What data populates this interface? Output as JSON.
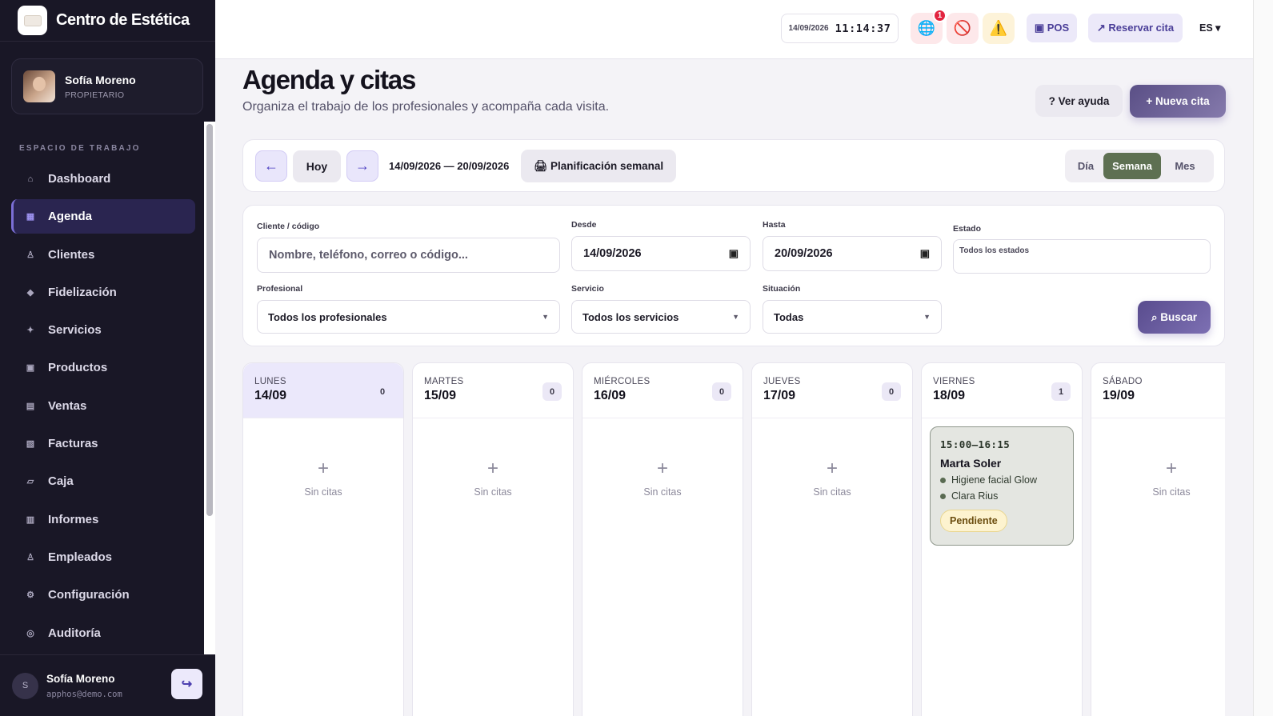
{
  "brand": {
    "name": "Centro de Estética"
  },
  "profile": {
    "name": "Sofía Moreno",
    "role": "PROPIETARIO"
  },
  "sidebar": {
    "section_label": "ESPACIO DE TRABAJO",
    "items": [
      {
        "label": "Dashboard",
        "icon": "⌂",
        "icon_name": "home-icon"
      },
      {
        "label": "Agenda",
        "icon": "▦",
        "icon_name": "calendar-icon",
        "active": true
      },
      {
        "label": "Clientes",
        "icon": "♙",
        "icon_name": "user-icon"
      },
      {
        "label": "Fidelización",
        "icon": "◆",
        "icon_name": "diamond-icon"
      },
      {
        "label": "Servicios",
        "icon": "✦",
        "icon_name": "sparkle-icon"
      },
      {
        "label": "Productos",
        "icon": "▣",
        "icon_name": "box-icon"
      },
      {
        "label": "Ventas",
        "icon": "▤",
        "icon_name": "receipt-icon"
      },
      {
        "label": "Facturas",
        "icon": "▧",
        "icon_name": "invoice-icon"
      },
      {
        "label": "Caja",
        "icon": "▱",
        "icon_name": "cash-register-icon"
      },
      {
        "label": "Informes",
        "icon": "▥",
        "icon_name": "report-icon"
      },
      {
        "label": "Empleados",
        "icon": "♙",
        "icon_name": "employees-icon"
      },
      {
        "label": "Configuración",
        "icon": "⚙",
        "icon_name": "gear-icon"
      },
      {
        "label": "Auditoría",
        "icon": "◎",
        "icon_name": "audit-icon"
      }
    ]
  },
  "footer": {
    "avatar": "S",
    "name": "Sofía Moreno",
    "email": "apphos@demo.com",
    "logout_icon": "↪"
  },
  "topbar": {
    "date": "14/09/2026",
    "time": "11:14:37",
    "globe_badge": "1",
    "pos_label": "▣ POS",
    "reserve_label": "↗ Reservar cita",
    "language": "ES ▾"
  },
  "header": {
    "title": "Agenda y citas",
    "subtitle": "Organiza el trabajo de los profesionales y acompaña cada visita.",
    "help_label": "? Ver ayuda",
    "new_label": "+ Nueva cita"
  },
  "toolbar": {
    "prev_icon": "←",
    "today_label": "Hoy",
    "next_icon": "→",
    "range": "14/09/2026 — 20/09/2026",
    "plan_icon": "🖨",
    "plan_label": "Planificación semanal",
    "views": {
      "day": "Día",
      "week": "Semana",
      "month": "Mes"
    }
  },
  "filters": {
    "client_label": "Cliente / código",
    "client_placeholder": "Nombre, teléfono, correo o código...",
    "from_label": "Desde",
    "from_value": "14/09/2026",
    "to_label": "Hasta",
    "to_value": "20/09/2026",
    "state_label": "Estado",
    "state_value": "Todos los estados",
    "professional_label": "Profesional",
    "professional_value": "Todos los profesionales",
    "service_label": "Servicio",
    "service_value": "Todos los servicios",
    "situation_label": "Situación",
    "situation_value": "Todas",
    "search_label": "⌕ Buscar"
  },
  "week": {
    "empty_plus": "+",
    "empty_text": "Sin citas",
    "days": [
      {
        "name": "LUNES",
        "date": "14/09",
        "count": "0"
      },
      {
        "name": "MARTES",
        "date": "15/09",
        "count": "0"
      },
      {
        "name": "MIÉRCOLES",
        "date": "16/09",
        "count": "0"
      },
      {
        "name": "JUEVES",
        "date": "17/09",
        "count": "0"
      },
      {
        "name": "VIERNES",
        "date": "18/09",
        "count": "1"
      },
      {
        "name": "SÁBADO",
        "date": "19/09",
        "count": ""
      }
    ],
    "appointment": {
      "time": "15:00–16:15",
      "client": "Marta Soler",
      "service": "Higiene facial Glow",
      "professional": "Clara Rius",
      "status": "Pendiente"
    }
  },
  "colors": {
    "sidebar_bg": "#191726",
    "accent": "#7b6fd6",
    "week_active": "#5e7052",
    "status_pending": "#fdf3cf"
  }
}
